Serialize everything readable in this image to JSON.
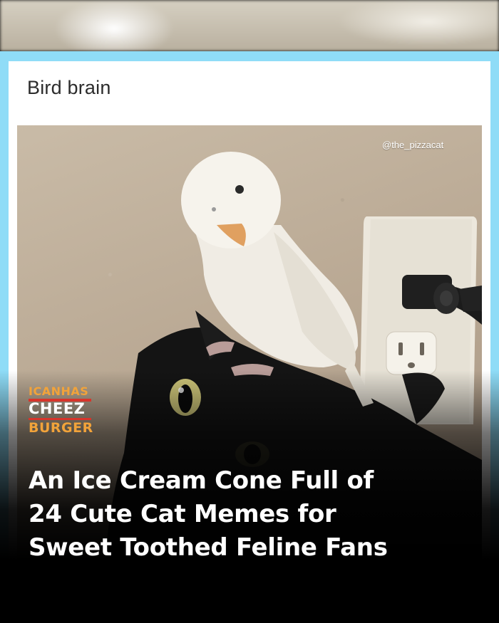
{
  "meme": {
    "title": "Bird brain",
    "watermark": "@the_pizzacat"
  },
  "brand": {
    "logo_line1": "ICANHAS",
    "logo_line2": "CHEEZ",
    "logo_line3": "BURGER",
    "accent_color": "#f2a33a",
    "frame_color": "#8fdcf7"
  },
  "headline": {
    "lines": [
      "An Ice Cream Cone Full of",
      "24 Cute Cat Memes for",
      "Sweet Toothed Feline Fans"
    ]
  }
}
